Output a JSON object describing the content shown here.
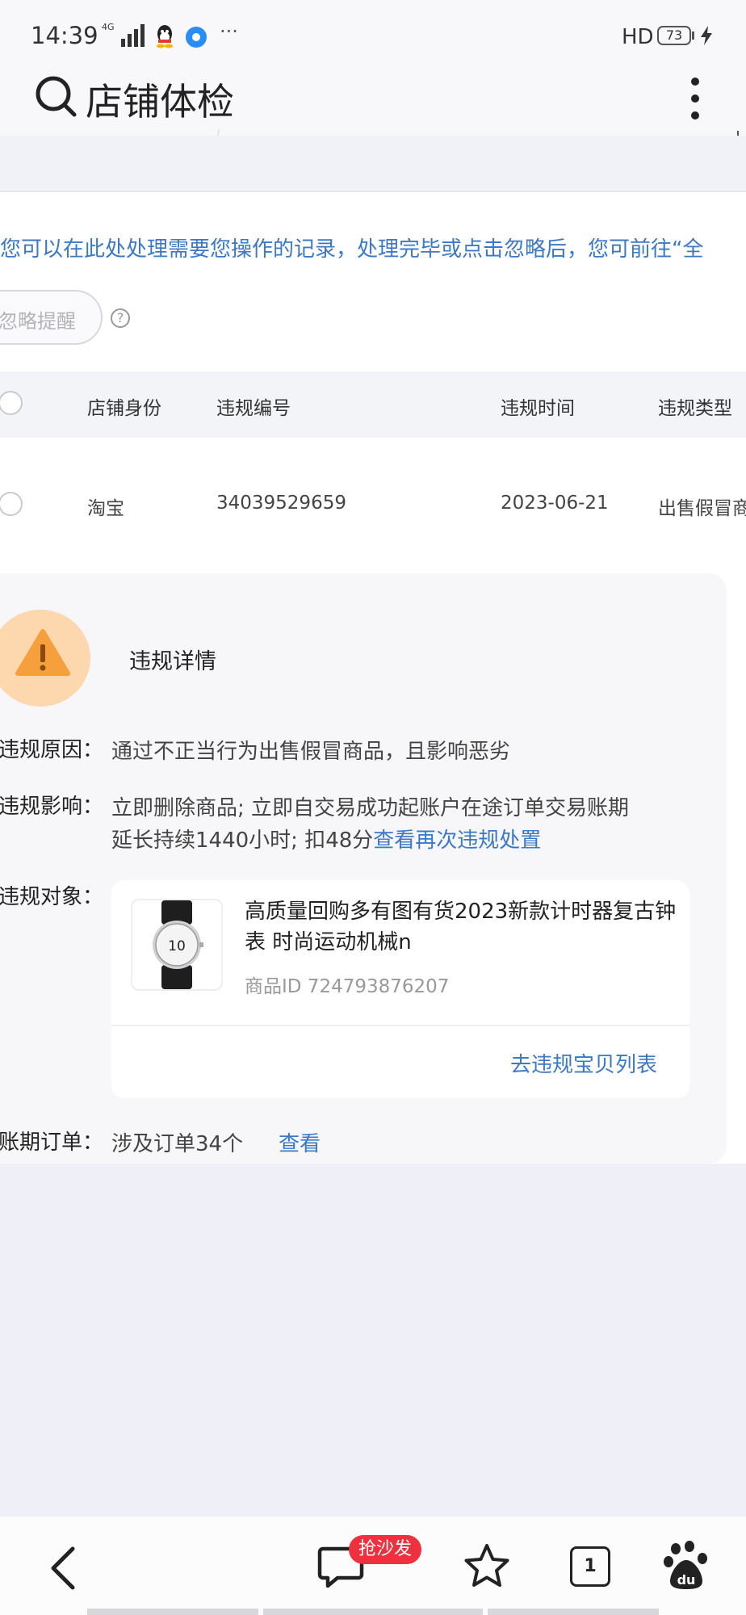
{
  "status_bar": {
    "time": "14:39",
    "network": "4G",
    "more": "···",
    "hd": "HD",
    "battery": "73",
    "icons": [
      "signal-icon",
      "qq-icon",
      "app-icon",
      "bolt-icon"
    ]
  },
  "header": {
    "title": "店铺体检",
    "icons": [
      "search-icon",
      "more-vertical-icon"
    ]
  },
  "notice": "您可以在此处处理需要您操作的记录，处理完毕或点击忽略后，您可前往“全",
  "ignore_button": "忽略提醒",
  "help_icon_glyph": "?",
  "table": {
    "columns": [
      "店铺身份",
      "违规编号",
      "违规时间",
      "违规类型"
    ],
    "rows": [
      {
        "shop": "淘宝",
        "id": "34039529659",
        "date": "2023-06-21",
        "type": "出售假冒商"
      }
    ]
  },
  "detail": {
    "title": "违规详情",
    "reason_label": "违规原因：",
    "reason": "通过不正当行为出售假冒商品，且影响恶劣",
    "impact_label": "违规影响：",
    "impact_line1": "立即删除商品; 立即自交易成功起账户在途订单交易账期",
    "impact_line2": "延长持续1440小时; 扣48分",
    "impact_link": "查看再次违规处置",
    "object_label": "违规对象：",
    "product": {
      "name": "高质量回购多有图有货2023新款计时器复古钟表 时尚运动机械n",
      "id_text": "商品ID 724793876207",
      "watch_dial_number": "10",
      "link": "去违规宝贝列表"
    },
    "orders_label": "账期订单：",
    "orders_value": "涉及订单34个",
    "orders_link": "查看"
  },
  "bottom_bar": {
    "badge": "抢沙发",
    "tab_count": "1",
    "icons": [
      "back-icon",
      "comment-icon",
      "star-icon",
      "tabs-icon",
      "baidu-paw-icon"
    ]
  },
  "colors": {
    "link_blue": "#3b78c6",
    "warning_orange": "#f5a03c",
    "warning_bg": "#fdd7ad",
    "badge_red": "#f0303f",
    "page_bg": "#eff0f7"
  }
}
